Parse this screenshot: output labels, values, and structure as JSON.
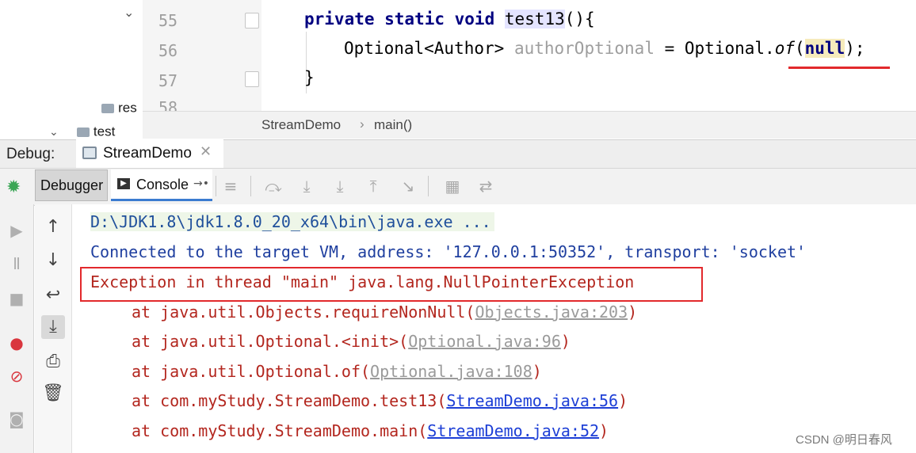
{
  "project_tree": {
    "items": [
      {
        "label": "res"
      },
      {
        "label": "test"
      }
    ]
  },
  "editor": {
    "line_numbers": [
      "55",
      "56",
      "57",
      "58"
    ],
    "line55": {
      "keywords": "private static void",
      "method": "test13",
      "rest": "(){"
    },
    "line56": {
      "type": "Optional<Author>",
      "var": "authorOptional",
      "assign": " = Optional.",
      "call": "of",
      "open": "(",
      "arg": "null",
      "close": ");"
    },
    "line57": "}"
  },
  "breadcrumb": {
    "file": "StreamDemo",
    "sep": "›",
    "method": "main()"
  },
  "debug": {
    "label": "Debug:",
    "session_tab": "StreamDemo",
    "tabs": {
      "debugger": "Debugger",
      "console": "Console"
    }
  },
  "console": {
    "lines": {
      "cmd": "D:\\JDK1.8\\jdk1.8.0_20_x64\\bin\\java.exe ...",
      "connected": "Connected to the target VM, address: '127.0.0.1:50352', transport: 'socket'",
      "exception": "Exception in thread \"main\" java.lang.NullPointerException"
    },
    "trace": [
      {
        "prefix": "at java.util.Objects.requireNonNull(",
        "link": "Objects.java:203",
        "suffix": ")"
      },
      {
        "prefix": "at java.util.Optional.<init>(",
        "link": "Optional.java:96",
        "suffix": ")"
      },
      {
        "prefix": "at java.util.Optional.of(",
        "link": "Optional.java:108",
        "suffix": ")"
      },
      {
        "prefix": "at com.myStudy.StreamDemo.test13(",
        "link": "StreamDemo.java:56",
        "suffix": ")"
      },
      {
        "prefix": "at com.myStudy.StreamDemo.main(",
        "link": "StreamDemo.java:52",
        "suffix": ")"
      }
    ]
  },
  "watermark": "CSDN @明日春风",
  "colors": {
    "error": "#b3261e",
    "keyword": "#000080",
    "link": "#1d3fd6",
    "highlight_box": "#e2292c"
  }
}
